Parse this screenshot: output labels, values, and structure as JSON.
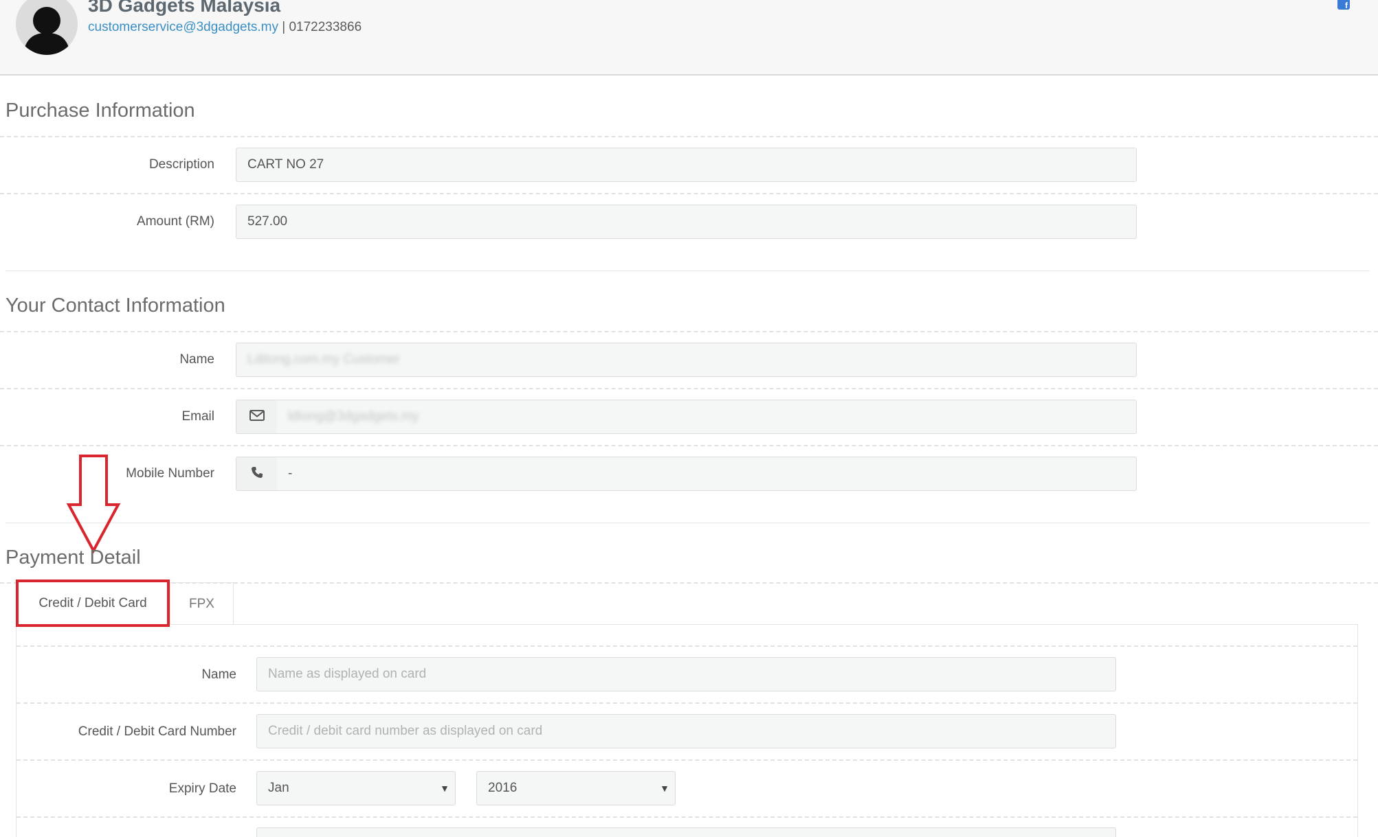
{
  "header": {
    "merchant_name": "3D Gadgets Malaysia",
    "email": "customerservice@3dgadgets.my",
    "separator": "|",
    "phone": "0172233866"
  },
  "purchase": {
    "title": "Purchase Information",
    "description_label": "Description",
    "description_value": "CART NO 27",
    "amount_label": "Amount (RM)",
    "amount_value": "527.00"
  },
  "contact": {
    "title": "Your Contact Information",
    "name_label": "Name",
    "name_value": "Lditong.com.my Customer",
    "email_label": "Email",
    "email_value": "ldtong@3dgadgets.my",
    "mobile_label": "Mobile Number",
    "mobile_value": "-"
  },
  "payment": {
    "title": "Payment Detail",
    "tabs": [
      {
        "label": "Credit / Debit Card",
        "active": true
      },
      {
        "label": "FPX",
        "active": false
      }
    ],
    "card_name_label": "Name",
    "card_name_placeholder": "Name as displayed on card",
    "card_number_label": "Credit / Debit Card Number",
    "card_number_placeholder": "Credit / debit card number as displayed on card",
    "expiry_label": "Expiry Date",
    "expiry_month": "Jan",
    "expiry_year": "2016"
  },
  "annotation": {
    "highlight_color": "#d9262e"
  },
  "icons": {
    "email_addon": "envelope-icon",
    "phone_addon": "phone-icon",
    "social": "facebook-icon"
  }
}
